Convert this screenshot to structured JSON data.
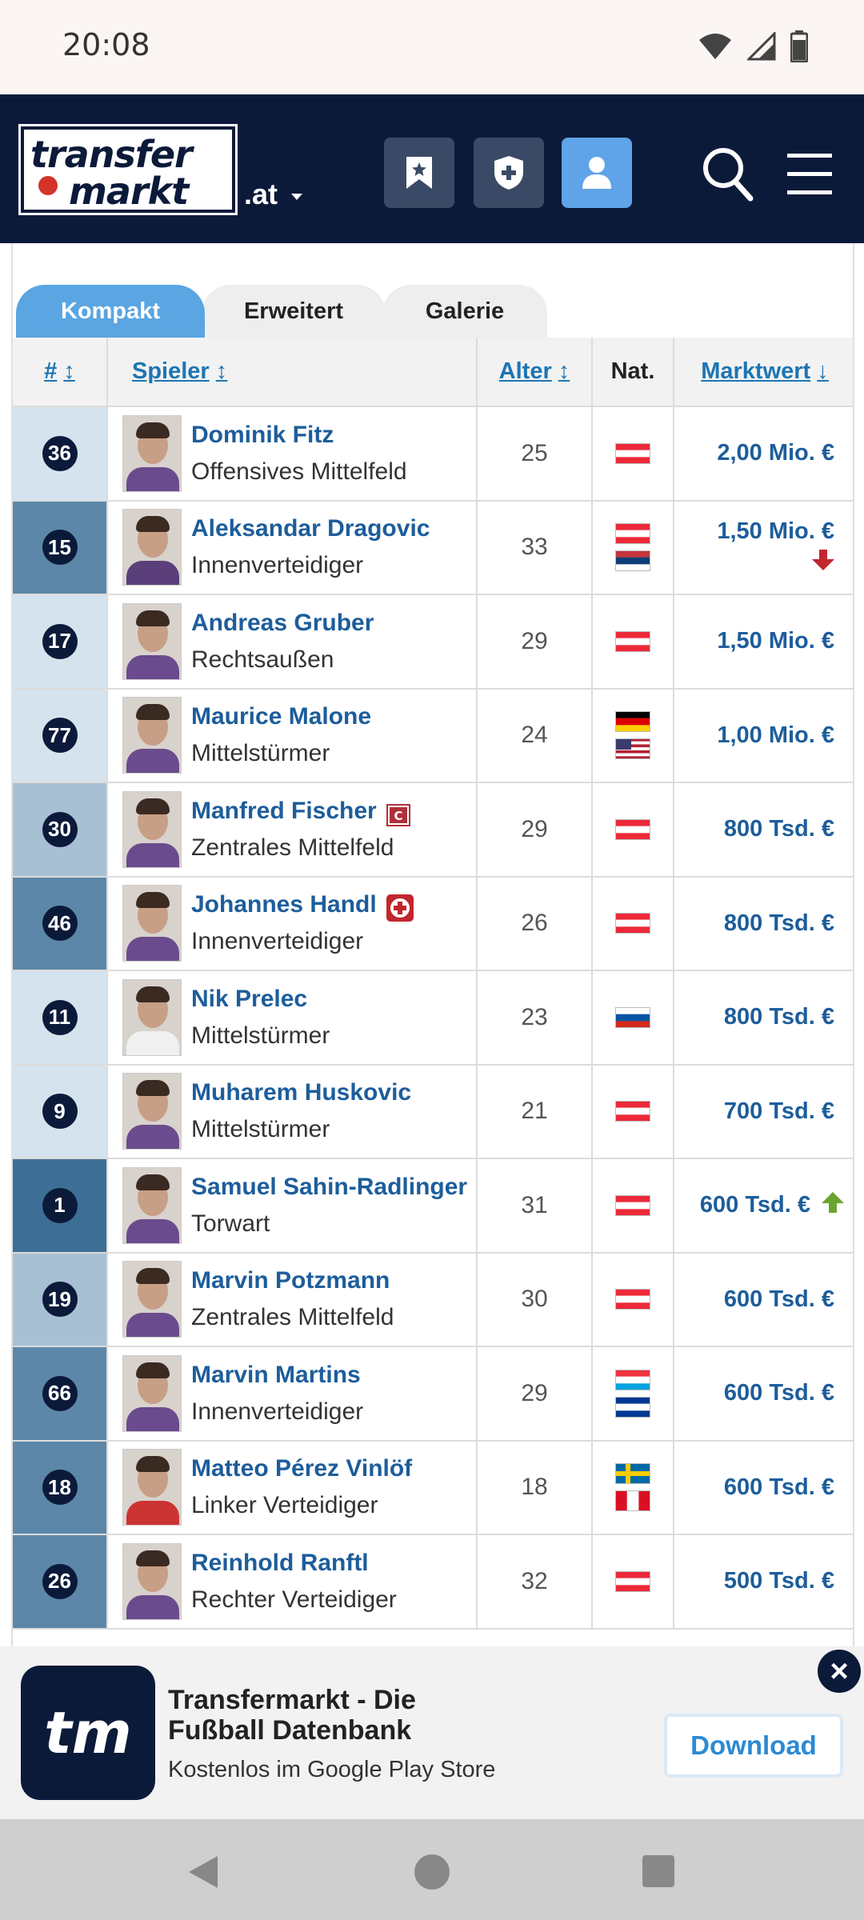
{
  "status_bar": {
    "time": "20:08"
  },
  "header": {
    "logo_line1": "transfer",
    "logo_line2": "markt",
    "domain": ".at",
    "icons": [
      "bookmark-icon",
      "shield-plus-icon",
      "user-icon",
      "search-icon",
      "menu-icon"
    ]
  },
  "tabs": [
    "Kompakt",
    "Erweitert",
    "Galerie"
  ],
  "columns": {
    "num": "#",
    "player": "Spieler",
    "age": "Alter",
    "nat": "Nat.",
    "value": "Marktwert"
  },
  "players": [
    {
      "num": "36",
      "name": "Dominik Fitz",
      "pos": "Offensives Mittelfeld",
      "age": "25",
      "flags": [
        "AUT"
      ],
      "value": "2,00 Mio. €",
      "trend": "",
      "rowcolor": "#d5e3ee",
      "badge": ""
    },
    {
      "num": "15",
      "name": "Aleksandar Dragovic",
      "pos": "Innenverteidiger",
      "age": "33",
      "flags": [
        "AUT",
        "SRB"
      ],
      "value": "1,50 Mio. €",
      "trend": "down",
      "rowcolor": "#5c87a8",
      "badge": ""
    },
    {
      "num": "17",
      "name": "Andreas Gruber",
      "pos": "Rechtsaußen",
      "age": "29",
      "flags": [
        "AUT"
      ],
      "value": "1,50 Mio. €",
      "trend": "",
      "rowcolor": "#d5e3ee",
      "badge": ""
    },
    {
      "num": "77",
      "name": "Maurice Malone",
      "pos": "Mittelstürmer",
      "age": "24",
      "flags": [
        "GER",
        "USA"
      ],
      "value": "1,00 Mio. €",
      "trend": "",
      "rowcolor": "#d5e3ee",
      "badge": ""
    },
    {
      "num": "30",
      "name": "Manfred Fischer",
      "pos": "Zentrales Mittelfeld",
      "age": "29",
      "flags": [
        "AUT"
      ],
      "value": "800 Tsd. €",
      "trend": "",
      "rowcolor": "#a8c0d4",
      "badge": "captain"
    },
    {
      "num": "46",
      "name": "Johannes Handl",
      "pos": "Innenverteidiger",
      "age": "26",
      "flags": [
        "AUT"
      ],
      "value": "800 Tsd. €",
      "trend": "",
      "rowcolor": "#5c87a8",
      "badge": "injury"
    },
    {
      "num": "11",
      "name": "Nik Prelec",
      "pos": "Mittelstürmer",
      "age": "23",
      "flags": [
        "SVN"
      ],
      "value": "800 Tsd. €",
      "trend": "",
      "rowcolor": "#d5e3ee",
      "badge": ""
    },
    {
      "num": "9",
      "name": "Muharem Huskovic",
      "pos": "Mittelstürmer",
      "age": "21",
      "flags": [
        "AUT"
      ],
      "value": "700 Tsd. €",
      "trend": "",
      "rowcolor": "#d5e3ee",
      "badge": ""
    },
    {
      "num": "1",
      "name": "Samuel Sahin-Radlinger",
      "pos": "Torwart",
      "age": "31",
      "flags": [
        "AUT"
      ],
      "value": "600 Tsd. €",
      "trend": "up",
      "rowcolor": "#3d6f96",
      "badge": ""
    },
    {
      "num": "19",
      "name": "Marvin Potzmann",
      "pos": "Zentrales Mittelfeld",
      "age": "30",
      "flags": [
        "AUT"
      ],
      "value": "600 Tsd. €",
      "trend": "",
      "rowcolor": "#a8c0d4",
      "badge": ""
    },
    {
      "num": "66",
      "name": "Marvin Martins",
      "pos": "Innenverteidiger",
      "age": "29",
      "flags": [
        "LUX",
        "CPV"
      ],
      "value": "600 Tsd. €",
      "trend": "",
      "rowcolor": "#5c87a8",
      "badge": ""
    },
    {
      "num": "18",
      "name": "Matteo Pérez Vinlöf",
      "pos": "Linker Verteidiger",
      "age": "18",
      "flags": [
        "SWE",
        "PER"
      ],
      "value": "600 Tsd. €",
      "trend": "",
      "rowcolor": "#5c87a8",
      "badge": ""
    },
    {
      "num": "26",
      "name": "Reinhold Ranftl",
      "pos": "Rechter Verteidiger",
      "age": "32",
      "flags": [
        "AUT"
      ],
      "value": "500 Tsd. €",
      "trend": "",
      "rowcolor": "#5c87a8",
      "badge": ""
    }
  ],
  "banner": {
    "icon_text": "tm",
    "title": "Transfermarkt - Die Fußball Datenbank",
    "subtitle": "Kostenlos im Google Play Store",
    "button": "Download",
    "close": "×"
  },
  "colors": {
    "header_bg": "#0c1a3a",
    "link": "#1d5d9b",
    "tab_active": "#5aa5e2"
  }
}
